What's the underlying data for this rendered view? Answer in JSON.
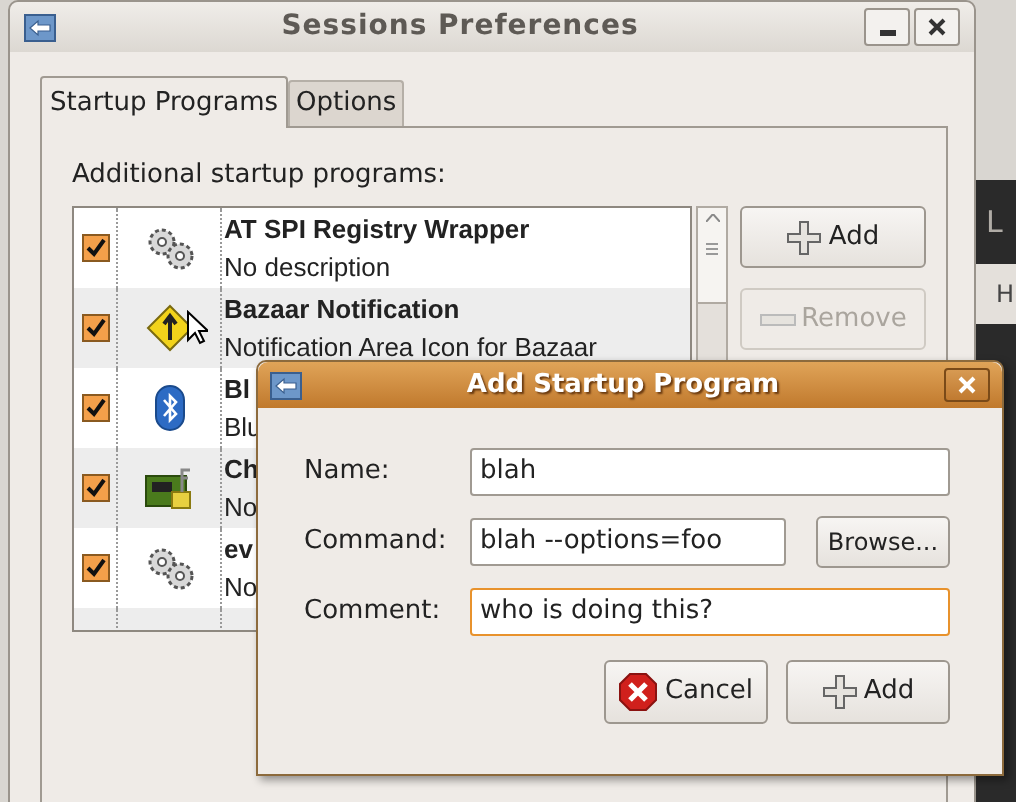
{
  "background_window": {
    "texts": [
      "L",
      "H"
    ]
  },
  "window": {
    "title": "Sessions Preferences"
  },
  "tabs": [
    {
      "label": "Startup Programs",
      "selected": true
    },
    {
      "label": "Options",
      "selected": false
    }
  ],
  "startup_list": {
    "label": "Additional startup programs:",
    "items": [
      {
        "name": "AT SPI Registry Wrapper",
        "description": "No description",
        "checked": true,
        "kind": "gears"
      },
      {
        "name": "Bazaar Notification",
        "description": "Notification Area Icon for Bazaar",
        "checked": true,
        "kind": "sign"
      },
      {
        "name": "Bl",
        "description": "Blu",
        "checked": true,
        "kind": "bluetooth"
      },
      {
        "name": "Ch",
        "description": "No",
        "checked": true,
        "kind": "card"
      },
      {
        "name": "ev",
        "description": "No",
        "checked": true,
        "kind": "gears"
      }
    ]
  },
  "buttons": [
    {
      "label": "Add",
      "disabled": false,
      "kind": "plus"
    },
    {
      "label": "Remove",
      "disabled": true,
      "kind": "minus"
    }
  ],
  "dialog": {
    "title": "Add Startup Program",
    "fields": [
      {
        "label": "Name:",
        "value": "blah",
        "focused": false
      },
      {
        "label": "Command:",
        "value": "blah --options=foo",
        "focused": false,
        "button": "Browse..."
      },
      {
        "label": "Comment:",
        "value": "who is doing this?",
        "focused": true
      }
    ],
    "buttons": [
      {
        "label": "Cancel",
        "kind": "cancel"
      },
      {
        "label": "Add",
        "kind": "plus"
      }
    ]
  }
}
